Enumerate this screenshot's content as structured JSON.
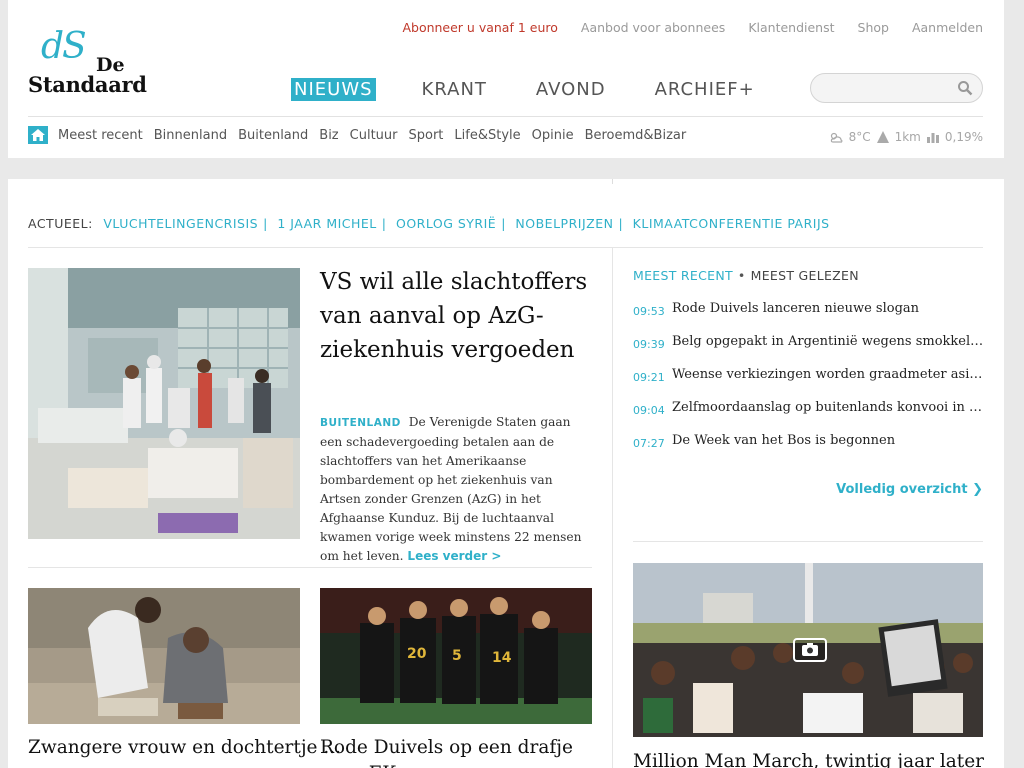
{
  "toplinks": {
    "promo": "Abonneer u vanaf 1 euro",
    "offer": "Aanbod voor abonnees",
    "service": "Klantendienst",
    "shop": "Shop",
    "login": "Aanmelden"
  },
  "logo": {
    "ds": "dS",
    "de": "De",
    "standaard": "Standaard"
  },
  "mainnav": [
    "NIEUWS",
    "KRANT",
    "AVOND",
    "ARCHIEF+"
  ],
  "search": {
    "placeholder": ""
  },
  "subnav": [
    "Meest recent",
    "Binnenland",
    "Buitenland",
    "Biz",
    "Cultuur",
    "Sport",
    "Life&Style",
    "Opinie",
    "Beroemd&Bizar"
  ],
  "weather": {
    "temp": "8°C",
    "visibility": "1km",
    "rain": "0,19%"
  },
  "actueel": {
    "label": "ACTUEEL:",
    "tags": [
      "VLUCHTELINGENCRISIS",
      "1 JAAR MICHEL",
      "OORLOG SYRIË",
      "NOBELPRIJZEN",
      "KLIMAATCONFERENTIE PARIJS"
    ]
  },
  "lead": {
    "title": "VS wil alle slachtoffers van aanval op AzG-ziekenhuis vergoeden",
    "section": "BUITENLAND",
    "body": "De Verenigde Staten gaan een schadevergoeding betalen aan de slachtoffers van het Amerikaanse bombardement op het ziekenhuis van Artsen zonder Grenzen (AzG) in het Afghaanse Kunduz. Bij de luchtaanval kwamen vorige week minstens 22 mensen om het leven.",
    "more": "Lees verder >"
  },
  "cards": [
    {
      "title": "Zwangere vrouw en dochtertje ..."
    },
    {
      "title": "Rode Duivels op een drafje naar EK"
    }
  ],
  "sidebar": {
    "tab_recent": "MEEST RECENT",
    "tab_read": "MEEST GELEZEN",
    "items": [
      {
        "time": "09:53",
        "text": "Rode Duivels lanceren nieuwe slogan"
      },
      {
        "time": "09:39",
        "text": "Belg opgepakt in Argentinië wegens smokkel van fo..."
      },
      {
        "time": "09:21",
        "text": "Weense verkiezingen worden graadmeter asielbeleid"
      },
      {
        "time": "09:04",
        "text": "Zelfmoordaanslag op buitenlands konvooi in Kaboel"
      },
      {
        "time": "07:27",
        "text": "De Week van het Bos is begonnen"
      }
    ],
    "overview": "Volledig overzicht ❯",
    "feature_title": "Million Man March, twintig jaar later"
  },
  "colors": {
    "accent": "#2fb0c9",
    "promo": "#c0392b"
  }
}
